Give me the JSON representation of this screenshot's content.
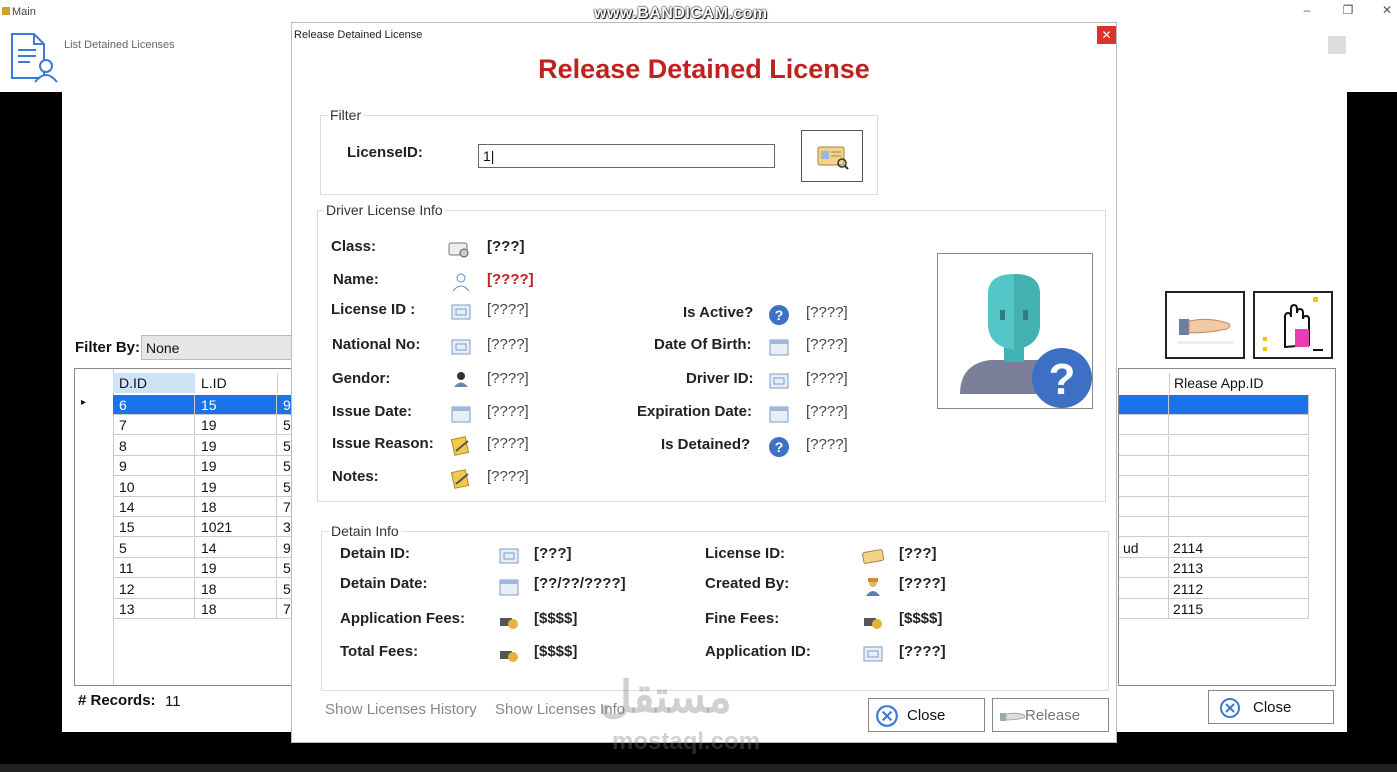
{
  "main_window": {
    "title": "Main",
    "controls": [
      "–",
      "❐",
      "✕"
    ]
  },
  "recorder_watermark": "www.BANDICAM.com",
  "list_form": {
    "title": "List Detained Licenses",
    "filter_by_label": "Filter By:",
    "filter_by_value": "None",
    "grid": {
      "columns": [
        "D.ID",
        "L.ID"
      ],
      "rows": [
        [
          "6",
          "15",
          "9"
        ],
        [
          "7",
          "19",
          "5"
        ],
        [
          "8",
          "19",
          "5"
        ],
        [
          "9",
          "19",
          "5"
        ],
        [
          "10",
          "19",
          "5"
        ],
        [
          "14",
          "18",
          "7"
        ],
        [
          "15",
          "1021",
          "3"
        ],
        [
          "5",
          "14",
          "9"
        ],
        [
          "11",
          "19",
          "5"
        ],
        [
          "12",
          "18",
          "5"
        ],
        [
          "13",
          "18",
          "7"
        ]
      ]
    },
    "right_grid": {
      "column": "Rlease App.ID",
      "rows": [
        [
          "",
          ""
        ],
        [
          "",
          ""
        ],
        [
          "",
          ""
        ],
        [
          "",
          ""
        ],
        [
          "",
          ""
        ],
        [
          "",
          ""
        ],
        [
          "",
          ""
        ],
        [
          "ud",
          "2114"
        ],
        [
          "",
          "2113"
        ],
        [
          "",
          "2112"
        ],
        [
          "",
          "2115"
        ]
      ]
    },
    "records_label": "# Records:",
    "records_value": "11",
    "close_label": "Close"
  },
  "dialog": {
    "window_title": "Release Detained License",
    "heading": "Release Detained License",
    "filter": {
      "legend": "Filter",
      "license_id_label": "LicenseID:",
      "license_id_value": "1|"
    },
    "driver_info": {
      "legend": "Driver License Info",
      "class_label": "Class:",
      "class_value": "[???]",
      "name_label": "Name:",
      "name_value": "[????]",
      "license_id_label": "License ID :",
      "license_id_value": "[????]",
      "national_no_label": "National No:",
      "national_no_value": "[????]",
      "gender_label": "Gendor:",
      "gender_value": "[????]",
      "issue_date_label": "Issue Date:",
      "issue_date_value": "[????]",
      "issue_reason_label": "Issue Reason:",
      "issue_reason_value": "[????]",
      "notes_label": "Notes:",
      "notes_value": "[????]",
      "is_active_label": "Is Active?",
      "is_active_value": "[????]",
      "dob_label": "Date Of Birth:",
      "dob_value": "[????]",
      "driver_id_label": "Driver ID:",
      "driver_id_value": "[????]",
      "expiration_label": "Expiration Date:",
      "expiration_value": "[????]",
      "is_detained_label": "Is Detained?",
      "is_detained_value": "[????]"
    },
    "detain_info": {
      "legend": "Detain Info",
      "detain_id_label": "Detain ID:",
      "detain_id_value": "[???]",
      "detain_date_label": "Detain Date:",
      "detain_date_value": "[??/??/????]",
      "app_fees_label": "Application Fees:",
      "app_fees_value": "[$$$$]",
      "total_fees_label": "Total Fees:",
      "total_fees_value": "[$$$$]",
      "license_id_label": "License ID:",
      "license_id_value": "[???]",
      "created_by_label": "Created By:",
      "created_by_value": "[????]",
      "fine_fees_label": "Fine Fees:",
      "fine_fees_value": "[$$$$]",
      "application_id_label": "Application ID:",
      "application_id_value": "[????]"
    },
    "show_history_link": "Show Licenses History",
    "show_info_link": "Show Licenses Info",
    "close_label": "Close",
    "release_label": "Release"
  },
  "site_watermark": {
    "arabic": "مستقل",
    "latin": "mostaql.com"
  },
  "colors": {
    "heading_red": "#c0201e",
    "selection_blue": "#1a73e8",
    "close_btn_red": "#d9342b"
  }
}
